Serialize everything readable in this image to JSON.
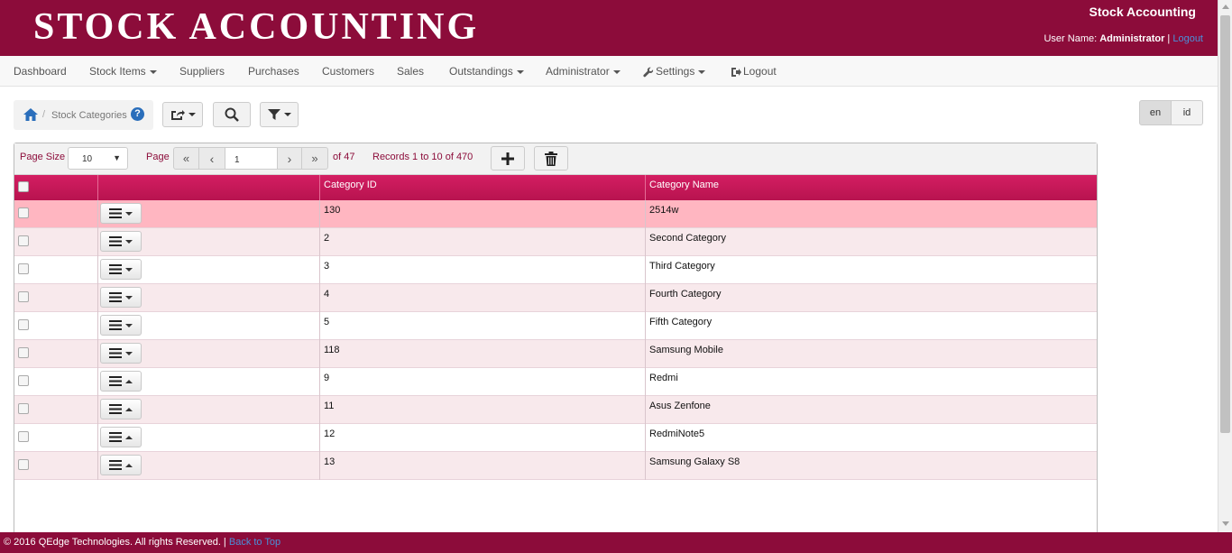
{
  "header": {
    "brand": "STOCK ACCOUNTING",
    "app_name": "Stock Accounting",
    "user_label": "User Name:",
    "user_name": "Administrator",
    "separator": "|",
    "logout_link": "Logout"
  },
  "nav": {
    "items": [
      {
        "label": "Dashboard"
      },
      {
        "label": "Stock Items"
      },
      {
        "label": "Suppliers"
      },
      {
        "label": "Purchases"
      },
      {
        "label": "Customers"
      },
      {
        "label": "Sales"
      },
      {
        "label": "Outstandings"
      },
      {
        "label": "Administrator"
      },
      {
        "label": "Settings"
      },
      {
        "label": "Logout"
      }
    ]
  },
  "breadcrumb": {
    "separator": "/",
    "current": "Stock Categories",
    "help": "?"
  },
  "lang": {
    "en": "en",
    "id": "id"
  },
  "pager": {
    "page_size_label": "Page Size",
    "page_size_value": "10",
    "page_label": "Page",
    "page_value": "1",
    "page_total": "of 47",
    "records": "Records 1 to 10 of 470"
  },
  "table": {
    "columns": [
      "Category ID",
      "Category Name"
    ],
    "rows": [
      {
        "id": "130",
        "name": "2514w",
        "selected": true
      },
      {
        "id": "2",
        "name": "Second Category"
      },
      {
        "id": "3",
        "name": "Third Category"
      },
      {
        "id": "4",
        "name": "Fourth Category"
      },
      {
        "id": "5",
        "name": "Fifth Category"
      },
      {
        "id": "118",
        "name": "Samsung Mobile"
      },
      {
        "id": "9",
        "name": "Redmi"
      },
      {
        "id": "11",
        "name": "Asus Zenfone"
      },
      {
        "id": "12",
        "name": "RedmiNote5"
      },
      {
        "id": "13",
        "name": "Samsung Galaxy S8"
      }
    ]
  },
  "footer": {
    "copyright": "© 2016 QEdge Technologies. All rights Reserved. |",
    "back_to_top": "Back to Top"
  },
  "colors": {
    "brand": "#8c0c3a",
    "header_gradient": "#d41e62",
    "selected_row": "#ffb6c1",
    "even_row": "#f8e9ec"
  }
}
